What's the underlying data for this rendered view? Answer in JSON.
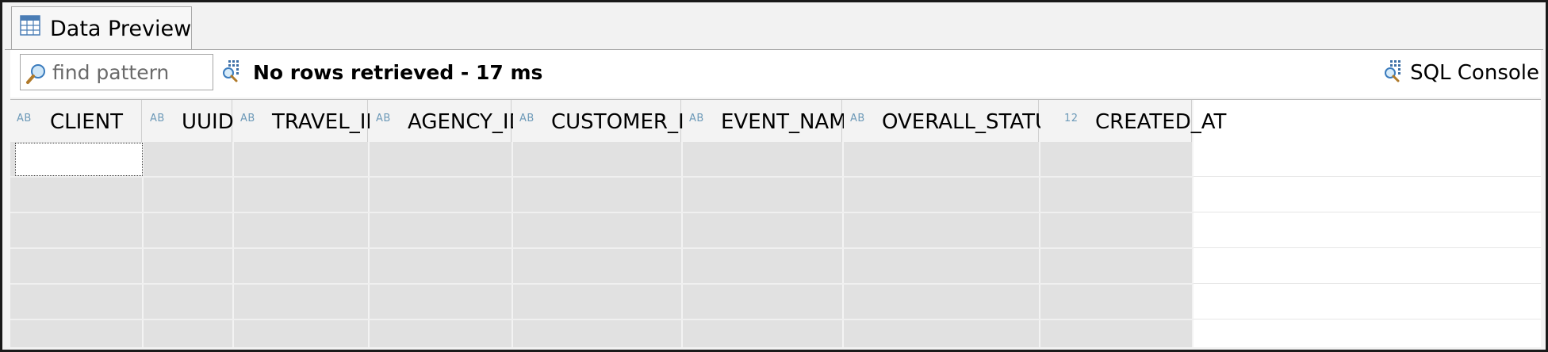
{
  "tab": {
    "label": "Data Preview",
    "icon": "table-icon"
  },
  "toolbar": {
    "find": {
      "placeholder": "find pattern",
      "value": "",
      "icon": "search-icon"
    },
    "status": {
      "text": "No rows retrieved - 17 ms",
      "icon": "query-icon"
    },
    "sql_console": {
      "label": "SQL Console",
      "icon": "query-icon"
    }
  },
  "grid": {
    "columns": [
      {
        "name": "CLIENT",
        "type": "AB"
      },
      {
        "name": "UUID",
        "type": "AB"
      },
      {
        "name": "TRAVEL_ID",
        "type": "AB"
      },
      {
        "name": "AGENCY_ID",
        "type": "AB"
      },
      {
        "name": "CUSTOMER_ID",
        "type": "AB"
      },
      {
        "name": "EVENT_NAME",
        "type": "AB"
      },
      {
        "name": "OVERALL_STATUS",
        "type": "AB"
      },
      {
        "name": "CREATED_AT",
        "type": "12"
      }
    ],
    "rows": []
  },
  "colors": {
    "header_bg": "#f3f3f3",
    "empty_cell_bg": "#e1e1e1",
    "type_hint": "#6d9ab8"
  }
}
